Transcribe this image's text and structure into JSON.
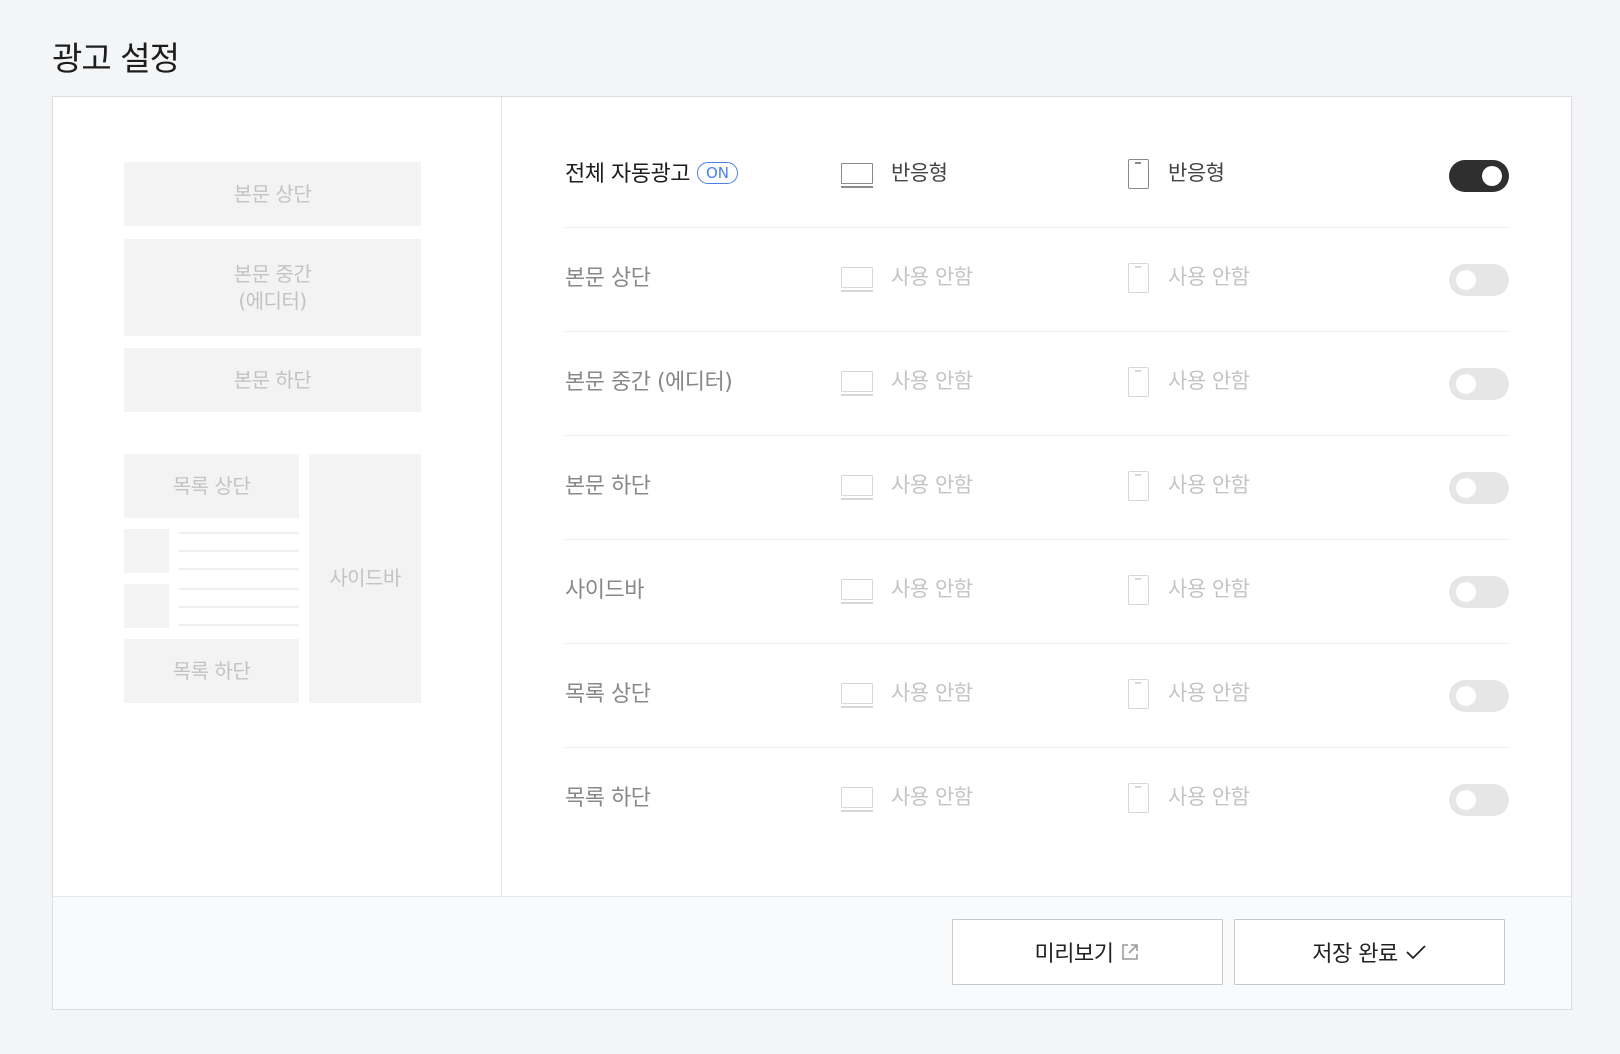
{
  "page": {
    "title": "광고 설정"
  },
  "preview_layout": {
    "body_top": "본문 상단",
    "body_middle_line1": "본문 중간",
    "body_middle_line2": "(에디터)",
    "body_bottom": "본문 하단",
    "list_top": "목록 상단",
    "list_bottom": "목록 하단",
    "sidebar": "사이드바"
  },
  "rows": [
    {
      "label": "전체 자동광고",
      "badge": "ON",
      "pc_value": "반응형",
      "mobile_value": "반응형",
      "enabled": true
    },
    {
      "label": "본문 상단",
      "pc_value": "사용 안함",
      "mobile_value": "사용 안함",
      "enabled": false
    },
    {
      "label": "본문 중간 (에디터)",
      "pc_value": "사용 안함",
      "mobile_value": "사용 안함",
      "enabled": false
    },
    {
      "label": "본문 하단",
      "pc_value": "사용 안함",
      "mobile_value": "사용 안함",
      "enabled": false
    },
    {
      "label": "사이드바",
      "pc_value": "사용 안함",
      "mobile_value": "사용 안함",
      "enabled": false
    },
    {
      "label": "목록 상단",
      "pc_value": "사용 안함",
      "mobile_value": "사용 안함",
      "enabled": false
    },
    {
      "label": "목록 하단",
      "pc_value": "사용 안함",
      "mobile_value": "사용 안함",
      "enabled": false
    }
  ],
  "footer": {
    "preview_label": "미리보기",
    "preview_icon": "external-link-icon",
    "save_label": "저장 완료",
    "save_icon": "check-icon"
  },
  "colors": {
    "toggle_on": "#2f2f2f",
    "toggle_off": "#e6e6e6",
    "badge_blue": "#4a80e6"
  }
}
